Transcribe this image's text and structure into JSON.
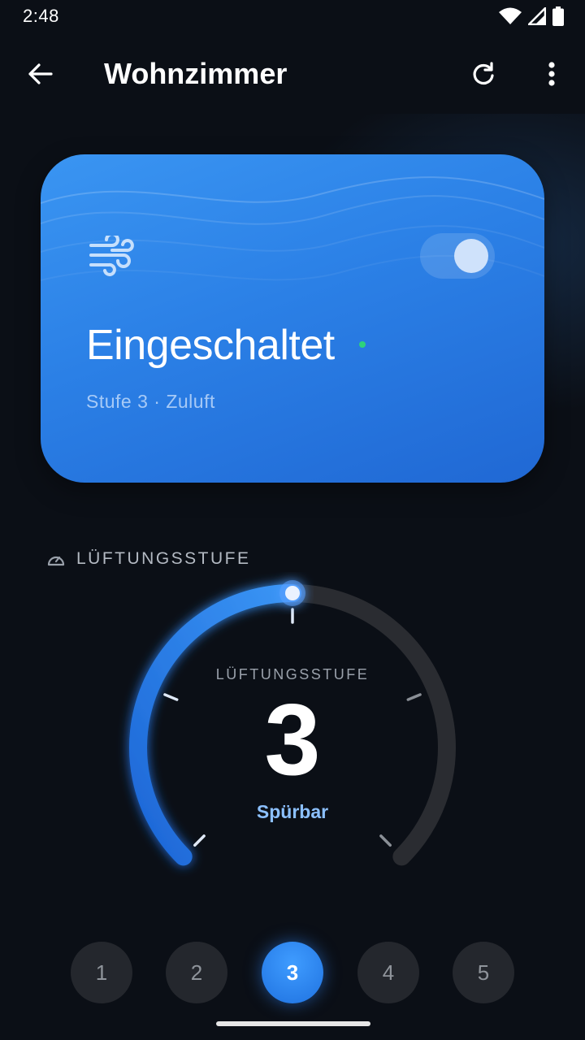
{
  "status_bar": {
    "time": "2:48",
    "icons": [
      "wifi-icon",
      "cell-signal-icon",
      "battery-icon"
    ]
  },
  "app_bar": {
    "title": "Wohnzimmer",
    "back_icon": "arrow-left-icon",
    "refresh_icon": "refresh-icon",
    "more_icon": "more-vertical-icon"
  },
  "status_card": {
    "icon": "fan-wind-icon",
    "power_on": true,
    "state": "Eingeschaltet",
    "subtitle": "Stufe 3 · Zuluft",
    "colors": {
      "card_start": "#3a95f2",
      "card_end": "#2068d4",
      "online_dot": "#2ed27a"
    }
  },
  "section": {
    "icon": "gauge-icon",
    "label": "LÜFTUNGSSTUFE"
  },
  "dial": {
    "caption": "LÜFTUNGSSTUFE",
    "value": "3",
    "description": "Spürbar",
    "level": 3,
    "max_level": 5,
    "colors": {
      "active": "#2f86f0",
      "track": "#2a2c31",
      "description": "#8cc0ff"
    }
  },
  "level_selector": {
    "options": [
      "1",
      "2",
      "3",
      "4",
      "5"
    ],
    "selected": "3"
  },
  "colors": {
    "background": "#0b0f16",
    "accent": "#2f86f0"
  }
}
